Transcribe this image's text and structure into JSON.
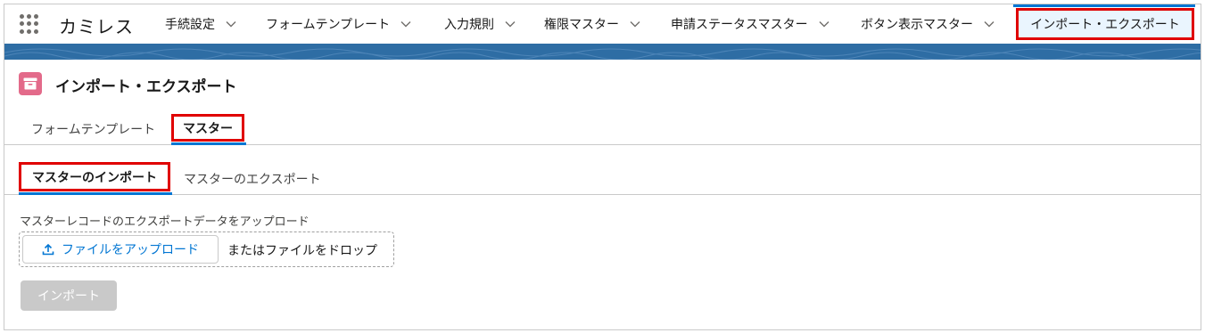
{
  "app": {
    "name": "カミレス"
  },
  "nav": {
    "items": [
      {
        "label": "手続設定"
      },
      {
        "label": "フォームテンプレート"
      },
      {
        "label": "入力規則"
      },
      {
        "label": "権限マスター"
      },
      {
        "label": "申請ステータスマスター"
      },
      {
        "label": "ボタン表示マスター"
      }
    ],
    "active": {
      "label": "インポート・エクスポート"
    }
  },
  "header": {
    "title": "インポート・エクスポート",
    "icon": "archive-icon"
  },
  "tabs": [
    {
      "label": "フォームテンプレート",
      "selected": false
    },
    {
      "label": "マスター",
      "selected": true
    }
  ],
  "subtabs": [
    {
      "label": "マスターのインポート",
      "selected": true
    },
    {
      "label": "マスターのエクスポート",
      "selected": false
    }
  ],
  "upload": {
    "label": "マスターレコードのエクスポートデータをアップロード",
    "button_label": "ファイルをアップロード",
    "drop_text": "またはファイルをドロップ"
  },
  "import_button": {
    "label": "インポート",
    "disabled": true
  },
  "colors": {
    "accent": "#0176d3",
    "highlight": "#e00000",
    "band": "#2e6da4",
    "icon_bg": "#e36a8a"
  }
}
